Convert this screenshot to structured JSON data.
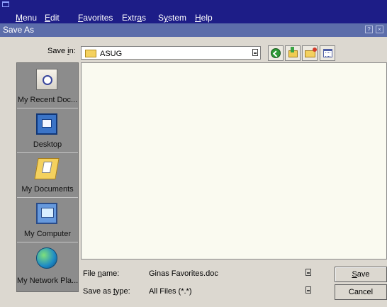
{
  "menubar": {
    "items": [
      {
        "pre": "",
        "u": "M",
        "post": "enu"
      },
      {
        "pre": "",
        "u": "E",
        "post": "dit"
      },
      {
        "pre": "",
        "u": "F",
        "post": "avorites"
      },
      {
        "pre": "Extr",
        "u": "a",
        "post": "s"
      },
      {
        "pre": "S",
        "u": "y",
        "post": "stem"
      },
      {
        "pre": "",
        "u": "H",
        "post": "elp"
      }
    ]
  },
  "dialog": {
    "title": "Save As",
    "help_glyph": "?",
    "close_glyph": "×"
  },
  "save_in": {
    "label_pre": "Save ",
    "label_u": "i",
    "label_post": "n:",
    "value": "ASUG"
  },
  "places": [
    {
      "label": "My Recent Doc...",
      "icon": "recent-documents-icon"
    },
    {
      "label": "Desktop",
      "icon": "desktop-icon"
    },
    {
      "label": "My Documents",
      "icon": "my-documents-icon"
    },
    {
      "label": "My Computer",
      "icon": "my-computer-icon"
    },
    {
      "label": "My Network Pla...",
      "icon": "network-places-icon"
    }
  ],
  "file_name": {
    "label_pre": "File ",
    "label_u": "n",
    "label_post": "ame:",
    "value": "Ginas Favorites.doc"
  },
  "file_type": {
    "label_pre": "Save as ",
    "label_u": "t",
    "label_post": "ype:",
    "value": "All Files (*.*)"
  },
  "buttons": {
    "save_u": "S",
    "save_post": "ave",
    "cancel": "Cancel"
  },
  "colors": {
    "menubar_bg": "#1d1d87",
    "titlebar_bg": "#5c6daa",
    "dialog_bg": "#dcd8d0"
  }
}
